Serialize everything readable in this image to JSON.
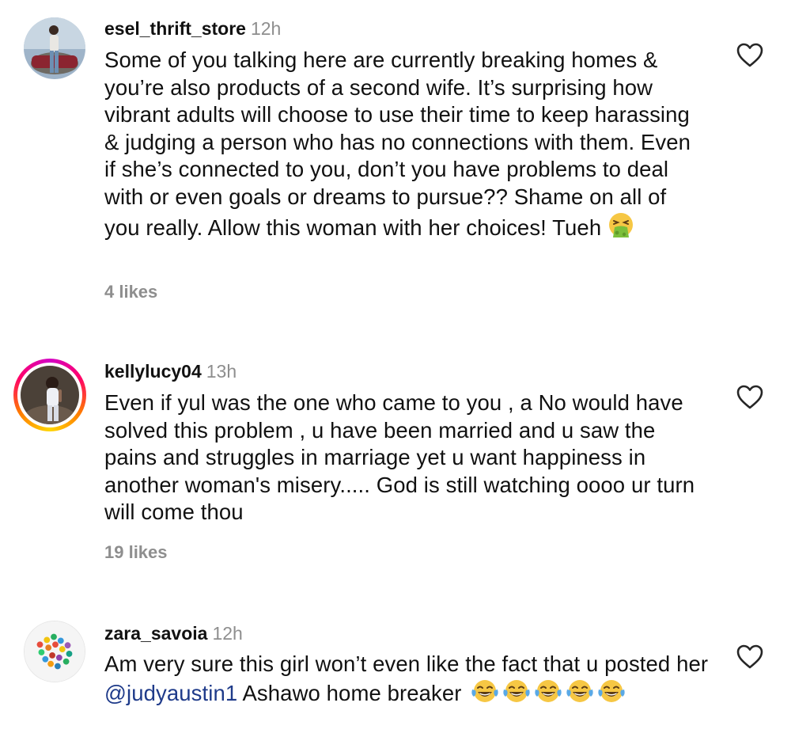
{
  "comments": [
    {
      "username": "esel_thrift_store",
      "time": "12h",
      "text": "Some of you talking here are currently breaking homes & you’re also products of a second wife. It’s surprising how vibrant adults will choose to use their time to keep harassing & judging a person who has no connections with them. Even if she’s connected to you, don’t you have problems to deal with or even goals or dreams to pursue?? Shame on all of you really. Allow this woman with her choices! Tueh",
      "emoji": "vomiting-face",
      "likes": "4 likes"
    },
    {
      "username": "kellylucy04",
      "time": "13h",
      "text": "Even if yul was the one who came to you , a No would have solved this problem , u have been married and u saw the pains and struggles in marriage yet u want happiness in another woman's misery..... God is still watching oooo ur turn will come thou",
      "likes": "19 likes",
      "story_ring": true
    },
    {
      "username": "zara_savoia",
      "time": "12h",
      "text_before": "Am very sure this girl won’t even like the fact that u posted her",
      "mention": "@judyaustin1",
      "text_after": "Ashawo home breaker",
      "emoji": "tears-of-joy-face",
      "emoji_count": 5
    }
  ],
  "colors": {
    "username": "#111111",
    "meta": "#8e8e8e",
    "mention": "#1f3b8a",
    "story_ring": [
      "#d300c5",
      "#ff0069",
      "#ff7a00",
      "#ffd600"
    ]
  },
  "icons": {
    "like": "heart-outline-icon"
  }
}
